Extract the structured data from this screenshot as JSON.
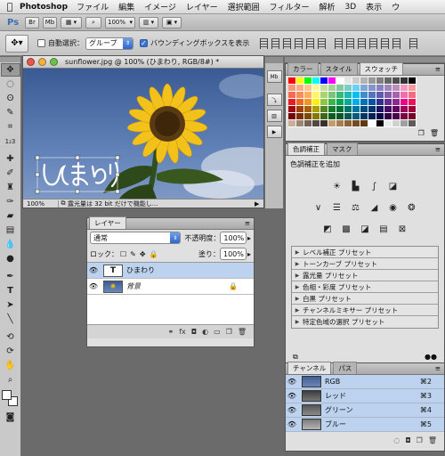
{
  "menubar": {
    "app_name": "Photoshop",
    "items": [
      "ファイル",
      "編集",
      "イメージ",
      "レイヤー",
      "選択範囲",
      "フィルター",
      "解析",
      "3D",
      "表示",
      "ウ"
    ]
  },
  "appbar": {
    "logo": "Ps",
    "bridge_button": "Br",
    "minibridge_button": "Mb",
    "zoom_level": "100%"
  },
  "options": {
    "auto_select_label": "自動選択：",
    "auto_select_checked": false,
    "auto_select_mode": "グループ",
    "bounding_box_label": "バウンディングボックスを表示",
    "bounding_box_checked": true
  },
  "document": {
    "title": "sunflower.jpg @ 100% (ひまわり, RGB/8#) *",
    "zoom": "100%",
    "status": "露光量は 32 bit だけで機能し...",
    "text_layer_content": "ひまわり"
  },
  "layers_panel": {
    "tab": "レイヤー",
    "blend_mode": "通常",
    "opacity_label": "不透明度：",
    "opacity_value": "100%",
    "lock_label": "ロック：",
    "fill_label": "塗り：",
    "fill_value": "100%",
    "layers": [
      {
        "name": "ひまわり",
        "type": "text",
        "thumb": "T",
        "selected": true
      },
      {
        "name": "背景",
        "type": "image",
        "locked": true,
        "selected": false
      }
    ]
  },
  "swatches_panel": {
    "tabs": [
      "カラー",
      "スタイル",
      "スウォッチ"
    ],
    "active_tab": "スウォッチ"
  },
  "adjustments_panel": {
    "tabs": [
      "色調補正",
      "マスク"
    ],
    "title": "色調補正を追加",
    "presets": [
      "レベル補正 プリセット",
      "トーンカーブ プリセット",
      "露光量 プリセット",
      "色相・彩度 プリセット",
      "白黒 プリセット",
      "チャンネルミキサー プリセット",
      "特定色域の選択 プリセット"
    ]
  },
  "channels_panel": {
    "tabs": [
      "チャンネル",
      "パス"
    ],
    "channels": [
      {
        "name": "RGB",
        "shortcut": "⌘2"
      },
      {
        "name": "レッド",
        "shortcut": "⌘3"
      },
      {
        "name": "グリーン",
        "shortcut": "⌘4"
      },
      {
        "name": "ブルー",
        "shortcut": "⌘5"
      }
    ]
  },
  "colors": {
    "selection_blue": "#bcd2ef",
    "sky_top": "#3a5a93",
    "sunflower_petal": "#f2c21b"
  }
}
